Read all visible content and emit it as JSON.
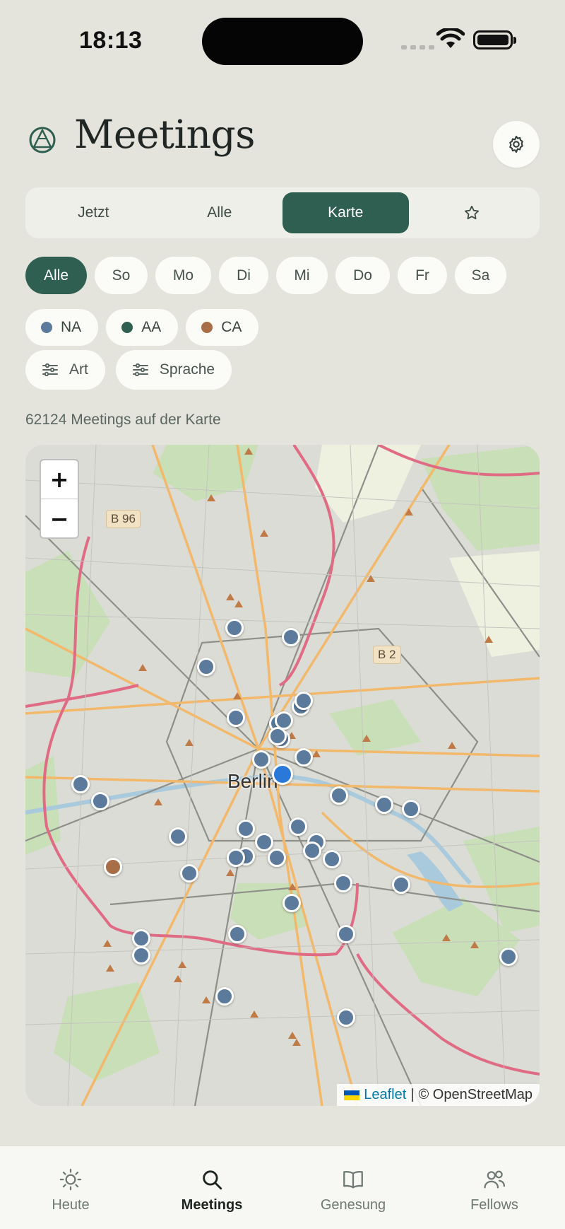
{
  "status_bar": {
    "time": "18:13"
  },
  "header": {
    "title": "Meetings"
  },
  "segments": [
    {
      "label": "Jetzt"
    },
    {
      "label": "Alle"
    },
    {
      "label": "Karte",
      "active": true
    },
    {
      "label": "",
      "icon": "star-icon"
    }
  ],
  "days": [
    "Alle",
    "So",
    "Mo",
    "Di",
    "Mi",
    "Do",
    "Fr",
    "Sa"
  ],
  "fellowships": [
    {
      "label": "NA",
      "color": "#5b7a9c"
    },
    {
      "label": "AA",
      "color": "#2f5f50"
    },
    {
      "label": "CA",
      "color": "#a86e47"
    }
  ],
  "filters": {
    "type_label": "Art",
    "language_label": "Sprache"
  },
  "map_info": {
    "count_text": "62124 Meetings auf der Karte"
  },
  "map": {
    "city_label": "Berlin",
    "road_signs": [
      "B 96",
      "B 2"
    ],
    "zoom_in": "+",
    "zoom_out": "−",
    "attribution": {
      "leaflet": "Leaflet",
      "separator": "|",
      "osm": "© OpenStreetMap"
    },
    "marker_colors": {
      "NA": "#5b7a9c",
      "CA": "#a86e47",
      "location": "#2a78d8"
    }
  },
  "tabbar": [
    {
      "label": "Heute",
      "icon": "sun-icon"
    },
    {
      "label": "Meetings",
      "icon": "search-icon",
      "active": true
    },
    {
      "label": "Genesung",
      "icon": "book-icon"
    },
    {
      "label": "Fellows",
      "icon": "people-icon"
    }
  ]
}
